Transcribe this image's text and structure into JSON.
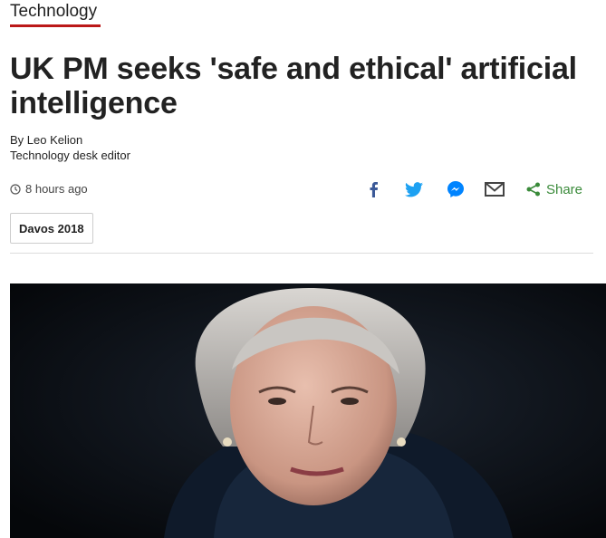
{
  "section": {
    "label": "Technology"
  },
  "article": {
    "headline": "UK PM seeks 'safe and ethical' artificial intelligence",
    "byline": {
      "author": "By Leo Kelion",
      "role": "Technology desk editor"
    },
    "timestamp": "8 hours ago",
    "tag": "Davos 2018"
  },
  "share": {
    "icons": [
      "facebook-icon",
      "twitter-icon",
      "messenger-icon",
      "email-icon",
      "share-icon"
    ],
    "label": "Share"
  },
  "colors": {
    "accent": "#bb1919",
    "facebook": "#3b5998",
    "twitter": "#1da1f2",
    "messenger": "#0084ff",
    "email": "#444444",
    "share": "#3b8b3b"
  }
}
